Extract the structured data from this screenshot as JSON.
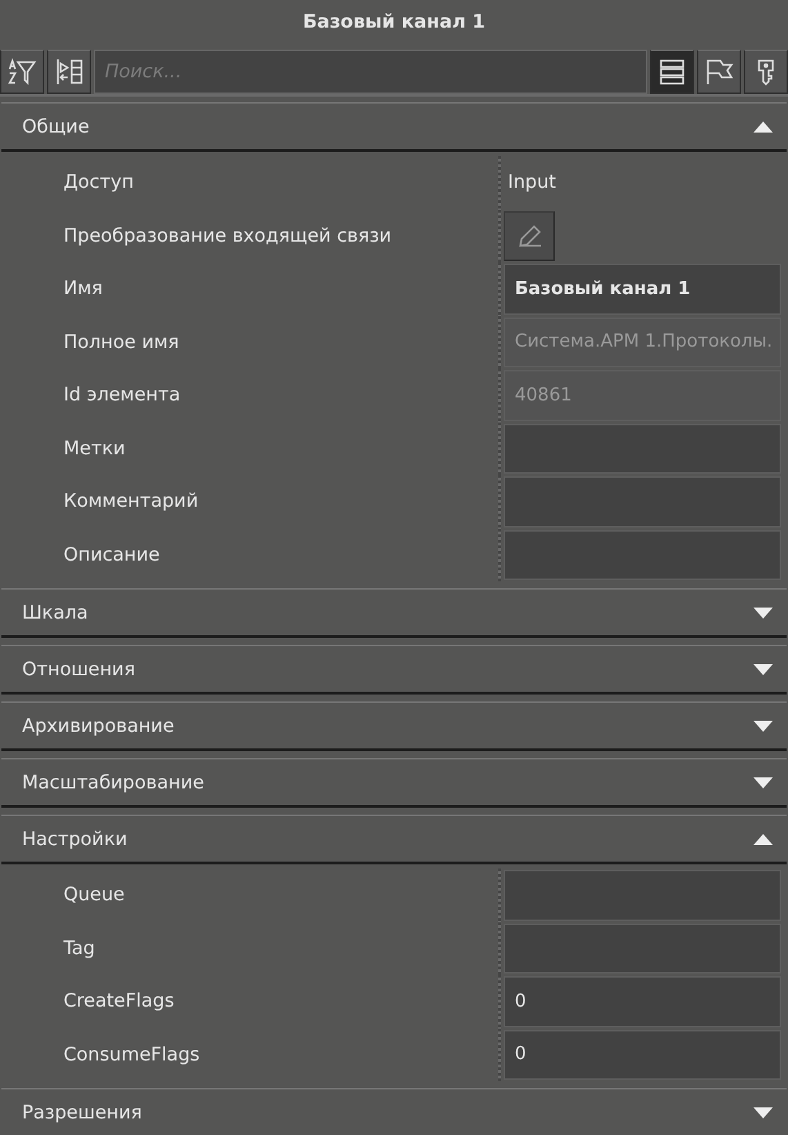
{
  "window": {
    "title": "Базовый канал 1"
  },
  "toolbar": {
    "left_buttons": [
      {
        "kind": "sort-filter"
      },
      {
        "kind": "expand"
      }
    ],
    "search": {
      "placeholder": "Поиск..."
    },
    "view_buttons": [
      {
        "kind": "list",
        "selected": true
      },
      {
        "kind": "flag",
        "selected": false
      },
      {
        "kind": "key",
        "selected": false
      }
    ]
  },
  "sections": [
    {
      "title": "Общие",
      "expanded": true,
      "properties": [
        {
          "label": "Доступ",
          "kind": "text",
          "value": "Input"
        },
        {
          "label": "Преобразование входящей связи",
          "kind": "edit-button"
        },
        {
          "label": "Имя",
          "kind": "field",
          "value": "Базовый канал 1",
          "bold": true,
          "disabled": false
        },
        {
          "label": "Полное имя",
          "kind": "field",
          "value": "Система.АРМ 1.Протоколы.",
          "bold": false,
          "disabled": true
        },
        {
          "label": "Id элемента",
          "kind": "field",
          "value": "40861",
          "bold": false,
          "disabled": true
        },
        {
          "label": "Метки",
          "kind": "field",
          "bold": false,
          "disabled": false
        },
        {
          "label": "Комментарий",
          "kind": "field",
          "bold": false,
          "disabled": false
        },
        {
          "label": "Описание",
          "kind": "field",
          "bold": false,
          "disabled": false
        }
      ]
    },
    {
      "title": "Шкала",
      "expanded": false
    },
    {
      "title": "Отношения",
      "expanded": false
    },
    {
      "title": "Архивирование",
      "expanded": false
    },
    {
      "title": "Масштабирование",
      "expanded": false
    },
    {
      "title": "Настройки",
      "expanded": true,
      "properties": [
        {
          "label": "Queue",
          "kind": "field",
          "bold": false,
          "disabled": false
        },
        {
          "label": "Tag",
          "kind": "field",
          "bold": false,
          "disabled": false
        },
        {
          "label": "CreateFlags",
          "kind": "field",
          "value": "0",
          "bold": false,
          "disabled": false
        },
        {
          "label": "ConsumeFlags",
          "kind": "field",
          "value": "0",
          "bold": false,
          "disabled": false
        }
      ]
    },
    {
      "title": "Разрешения",
      "expanded": false
    }
  ]
}
